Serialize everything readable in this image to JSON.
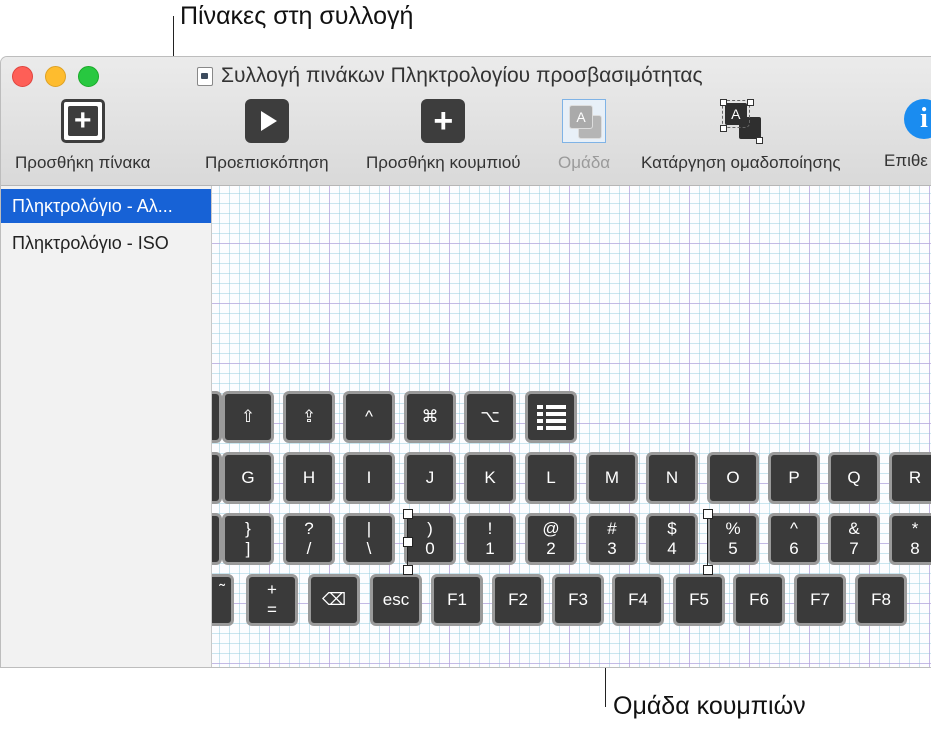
{
  "callouts": {
    "top": "Πίνακες στη συλλογή",
    "bottom": "Ομάδα κουμπιών"
  },
  "window": {
    "title": "Συλλογή πινάκων Πληκτρολογίου προσβασιμότητας"
  },
  "toolbar": {
    "add_panel": "Προσθήκη πίνακα",
    "preview": "Προεπισκόπηση",
    "add_button": "Προσθήκη κουμπιού",
    "group": "Ομάδα",
    "ungroup": "Κατάργηση ομαδοποίησης",
    "inspector": "Επιθε",
    "group_icon_letter": "A",
    "ungroup_icon_letter": "A"
  },
  "sidebar": {
    "items": [
      {
        "label": "Πληκτρολόγιο - Αλ..."
      },
      {
        "label": "Πληκτρολόγιο - ISO"
      }
    ]
  },
  "keyboard": {
    "row1": [
      "⇧",
      "⇪",
      "^",
      "⌘",
      "⌥"
    ],
    "row2": [
      "G",
      "H",
      "I",
      "J",
      "K",
      "L",
      "M",
      "N",
      "O",
      "P",
      "Q",
      "R"
    ],
    "row3": [
      {
        "top": "}",
        "bottom": "]"
      },
      {
        "top": "?",
        "bottom": "/"
      },
      {
        "top": "|",
        "bottom": "\\"
      },
      {
        "top": ")",
        "bottom": "0"
      },
      {
        "top": "!",
        "bottom": "1"
      },
      {
        "top": "@",
        "bottom": "2"
      },
      {
        "top": "#",
        "bottom": "3"
      },
      {
        "top": "$",
        "bottom": "4"
      },
      {
        "top": "%",
        "bottom": "5"
      },
      {
        "top": "^",
        "bottom": "6"
      },
      {
        "top": "&",
        "bottom": "7"
      },
      {
        "top": "*",
        "bottom": "8"
      }
    ],
    "row4_partial": "˜",
    "row4": [
      {
        "top": "+",
        "bottom": "="
      },
      {
        "single": "⌫"
      },
      {
        "single": "esc"
      },
      {
        "single": "F1"
      },
      {
        "single": "F2"
      },
      {
        "single": "F3"
      },
      {
        "single": "F4"
      },
      {
        "single": "F5"
      },
      {
        "single": "F6"
      },
      {
        "single": "F7"
      },
      {
        "single": "F8"
      }
    ]
  }
}
